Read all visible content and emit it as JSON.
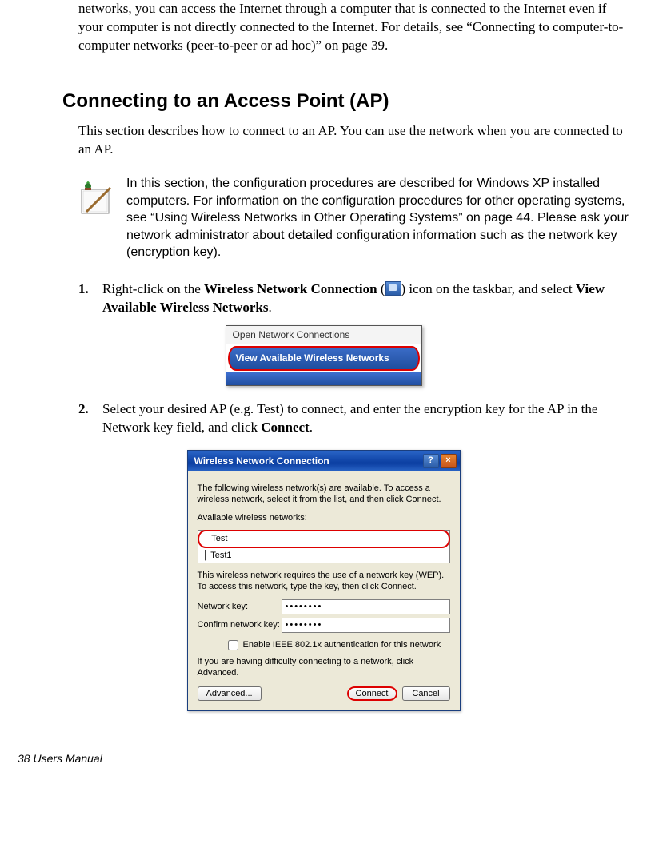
{
  "intro_paragraph": "networks, you can access the Internet through a computer that is connected to the Internet even if your computer is not directly connected to the Internet. For details, see “Connecting to computer-to-computer networks (peer-to-peer or ad hoc)” on page 39.",
  "section_heading": "Connecting to an Access Point (AP)",
  "section_intro": "This section describes how to connect to an AP. You can use the network when you are connected to an AP.",
  "note": "In this section, the configuration procedures are described for Windows XP installed computers. For information on the configuration procedures for other operating systems, see “Using Wireless Networks in Other Operating Systems” on page 44. Please ask your network administrator about detailed configuration information such as the network key (encryption key).",
  "steps": [
    {
      "num": "1.",
      "text_pre": "Right-click on the ",
      "bold1": "Wireless Network Connection",
      "text_mid1": " (",
      "text_mid2": ") icon on the taskbar, and select ",
      "bold2": "View Available Wireless Networks",
      "text_post": "."
    },
    {
      "num": "2.",
      "text_pre": "Select your desired AP (e.g. Test) to connect, and enter the encryption key for the AP in the Network key field, and click ",
      "bold1": "Connect",
      "text_post": "."
    }
  ],
  "context_menu": {
    "item1": "Open Network Connections",
    "item2": "View Available Wireless Networks"
  },
  "dialog": {
    "title": "Wireless Network Connection",
    "desc1": "The following wireless network(s) are available. To access a wireless network, select it from the list, and then click Connect.",
    "list_label": "Available wireless networks:",
    "networks": [
      "Test",
      "Test1"
    ],
    "desc2": "This wireless network requires the use of a network key (WEP). To access this network, type the key, then click Connect.",
    "key_label": "Network key:",
    "confirm_label": "Confirm network key:",
    "key_value": "••••••••",
    "confirm_value": "••••••••",
    "chk_label": "Enable IEEE 802.1x authentication for this network",
    "desc3": "If you are having difficulty connecting to a network, click Advanced.",
    "btn_advanced": "Advanced...",
    "btn_connect": "Connect",
    "btn_cancel": "Cancel",
    "help": "?",
    "close": "×"
  },
  "footer": "38  Users Manual"
}
